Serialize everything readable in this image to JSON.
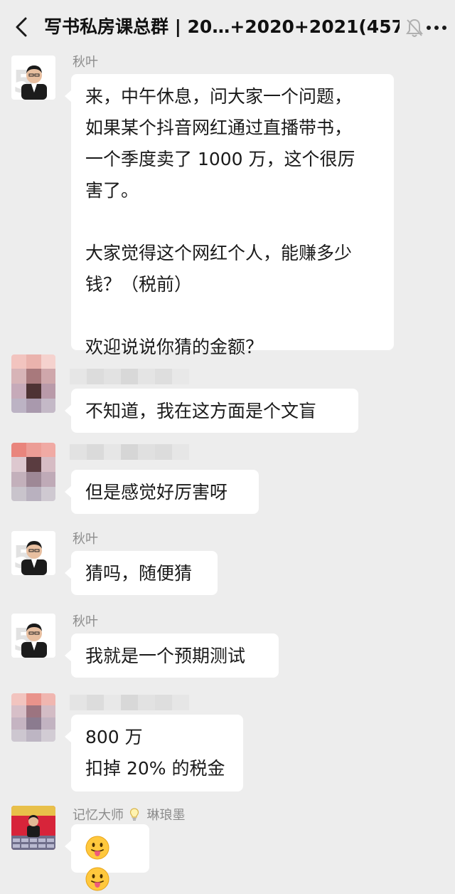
{
  "header": {
    "title": "写书私房课总群 | 20…+2020+2021(457)",
    "back_icon": "chevron-left-icon",
    "mute_icon": "bell-muted-icon",
    "more_icon": "more-dots-icon"
  },
  "messages": [
    {
      "sender": "秋叶",
      "lines": [
        "来，中午休息，问大家一个问题，",
        "如果某个抖音网红通过直播带书，",
        "一个季度卖了 1000 万，这个很厉",
        "害了。",
        "",
        "大家觉得这个网红个人，能赚多少",
        "钱？（税前）",
        "",
        "欢迎说说你猜的金额？"
      ]
    },
    {
      "sender": "",
      "lines": [
        "不知道，我在这方面是个文盲"
      ]
    },
    {
      "sender": "",
      "lines": [
        "但是感觉好厉害呀"
      ]
    },
    {
      "sender": "秋叶",
      "lines": [
        "猜吗，随便猜"
      ]
    },
    {
      "sender": "秋叶",
      "lines": [
        "我就是一个预期测试"
      ]
    },
    {
      "sender": "",
      "lines": [
        "800 万",
        "扣掉 20% 的税金"
      ]
    },
    {
      "sender": "记忆大师",
      "sender_badge": "lightbulb-icon",
      "sender_suffix": "琳琅墨",
      "emojis": [
        "tongue-out-emoji",
        "tongue-out-emoji"
      ]
    }
  ],
  "colors": {
    "background": "#ededed",
    "bubble": "#ffffff",
    "sender_text": "#8c8c8c"
  }
}
